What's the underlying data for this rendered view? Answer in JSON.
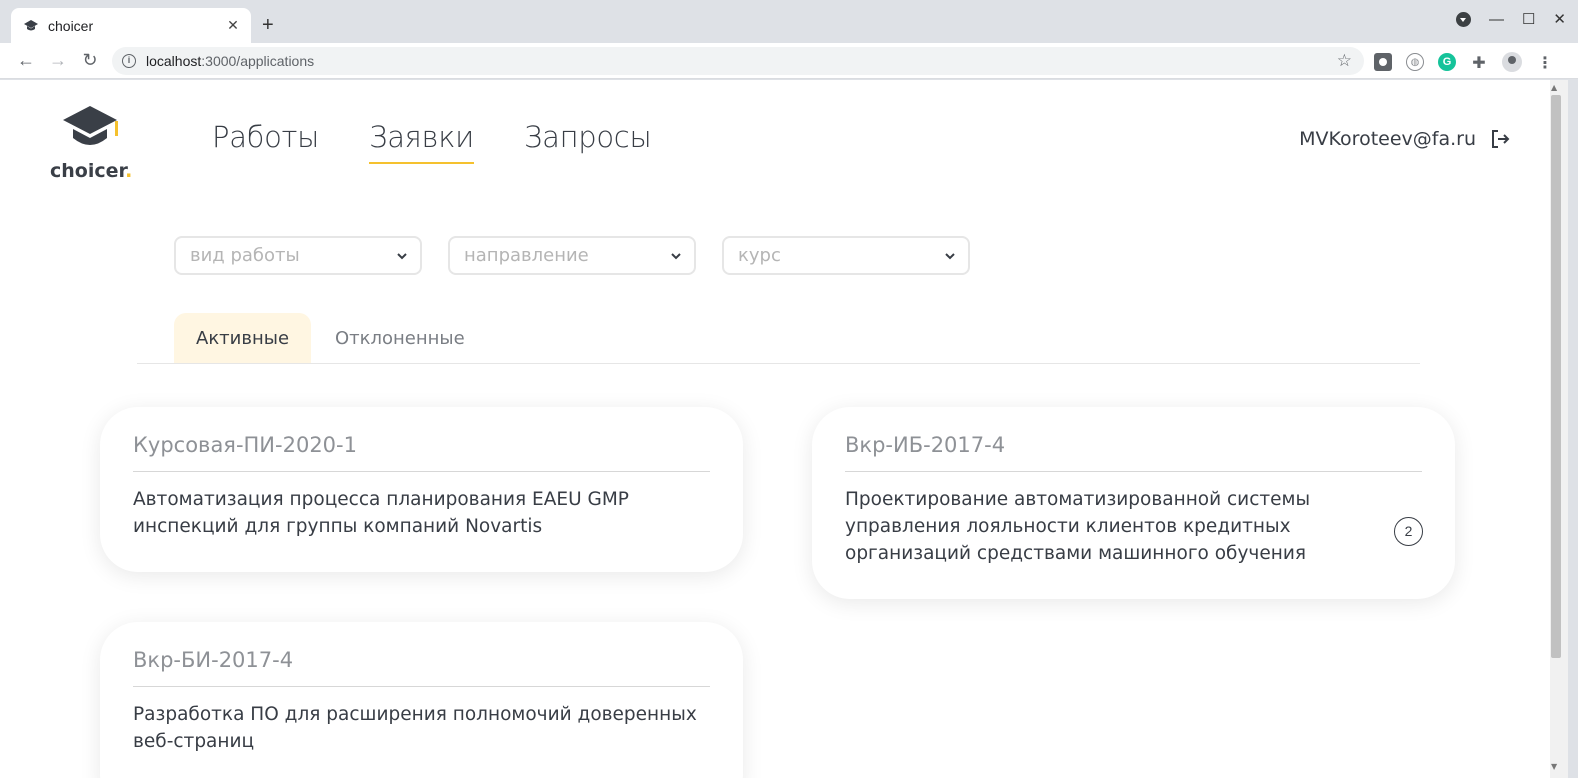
{
  "browser": {
    "tab_title": "choicer",
    "url_host": "localhost",
    "url_path": ":3000/applications",
    "new_tab_label": "+",
    "tab_close_label": "✕"
  },
  "app": {
    "logo_text": "choicer",
    "logo_dot": ".",
    "nav": [
      {
        "label": "Работы",
        "active": false
      },
      {
        "label": "Заявки",
        "active": true
      },
      {
        "label": "Запросы",
        "active": false
      }
    ],
    "user_email": "MVKoroteev@fa.ru",
    "accent_color": "#f5c12e"
  },
  "filters": [
    {
      "placeholder": "вид работы"
    },
    {
      "placeholder": "направление"
    },
    {
      "placeholder": "курс"
    }
  ],
  "tabs": [
    {
      "label": "Активные",
      "active": true
    },
    {
      "label": "Отклоненные",
      "active": false
    }
  ],
  "cards": [
    {
      "code": "Курсовая-ПИ-2020-1",
      "title_lines": [
        "Автоматизация процесса планирования EAEU GMP",
        "инспекций для группы компаний Novartis"
      ],
      "badge": null
    },
    {
      "code": "Вкр-ИБ-2017-4",
      "title_lines": [
        "Проектирование автоматизированной системы",
        "управления лояльности клиентов кредитных",
        "организаций средствами машинного обучения"
      ],
      "badge": "2"
    },
    {
      "code": "Вкр-БИ-2017-4",
      "title_lines": [
        "Разработка ПО для расширения полномочий доверенных",
        "веб-страниц"
      ],
      "badge": null
    }
  ]
}
